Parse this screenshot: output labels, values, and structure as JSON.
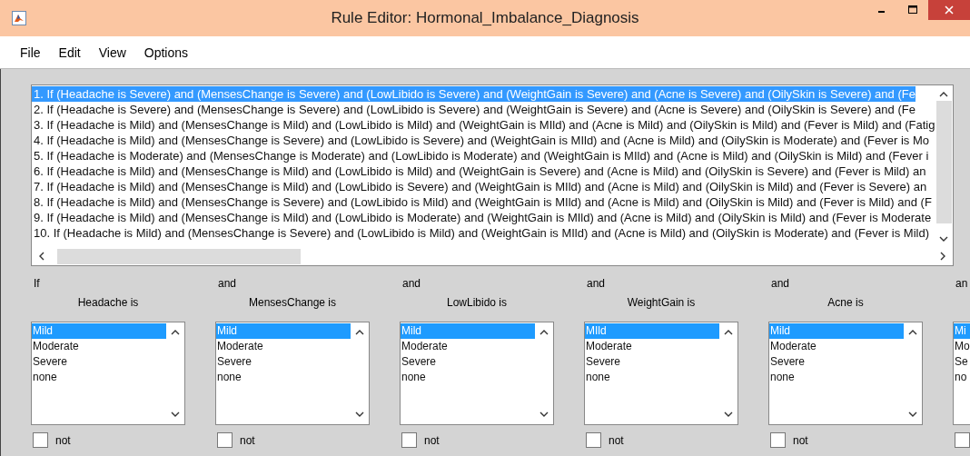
{
  "window": {
    "title": "Rule Editor: Hormonal_Imbalance_Diagnosis"
  },
  "menu": [
    "File",
    "Edit",
    "View",
    "Options"
  ],
  "rules": [
    {
      "text": "1. If (Headache is Severe) and (MensesChange is Severe) and (LowLibido is Severe) and (WeightGain is Severe) and (Acne is Severe) and (OilySkin is Severe) and (Fe",
      "selected": true
    },
    {
      "text": "2. If (Headache is Severe) and (MensesChange is Severe) and (LowLibido is Severe) and (WeightGain is Severe) and (Acne is Severe) and (OilySkin is Severe) and (Fe",
      "selected": false
    },
    {
      "text": "3. If (Headache is Mild) and (MensesChange is Mild) and (LowLibido is Mild) and (WeightGain is MIld) and (Acne is Mild) and (OilySkin is Mild) and (Fever is Mild) and (Fatig",
      "selected": false
    },
    {
      "text": "4. If (Headache is Mild) and (MensesChange is Severe) and (LowLibido is Severe) and (WeightGain is MIld) and (Acne is Mild) and (OilySkin is Moderate) and (Fever is Mo",
      "selected": false
    },
    {
      "text": "5. If (Headache is Moderate) and (MensesChange is Moderate) and (LowLibido is Moderate) and (WeightGain is MIld) and (Acne is Mild) and (OilySkin is Mild) and (Fever i",
      "selected": false
    },
    {
      "text": "6. If (Headache is Mild) and (MensesChange is Mild) and (LowLibido is Mild) and (WeightGain is Severe) and (Acne is Mild) and (OilySkin is Severe) and (Fever is Mild) an",
      "selected": false
    },
    {
      "text": "7. If (Headache is Mild) and (MensesChange is Mild) and (LowLibido is Severe) and (WeightGain is MIld) and (Acne is Mild) and (OilySkin is Mild) and (Fever is Severe) an",
      "selected": false
    },
    {
      "text": "8. If (Headache is Mild) and (MensesChange is Severe) and (LowLibido is Mild) and (WeightGain is MIld) and (Acne is Mild) and (OilySkin is Mild) and (Fever is Mild) and (F",
      "selected": false
    },
    {
      "text": "9. If (Headache is Mild) and (MensesChange is Mild) and (LowLibido is Moderate) and (WeightGain is MIld) and (Acne is Mild) and (OilySkin is Mild) and (Fever is Moderate",
      "selected": false
    },
    {
      "text": "10. If (Headache is Mild) and (MensesChange is Severe) and (LowLibido is Mild) and (WeightGain is MIld) and (Acne is Mild) and (OilySkin is Moderate) and (Fever is Mild)",
      "selected": false
    }
  ],
  "columns": [
    {
      "connector": "If",
      "header": "Headache is",
      "options": [
        {
          "label": "Mild",
          "selected": true
        },
        {
          "label": "Moderate",
          "selected": false
        },
        {
          "label": "Severe",
          "selected": false
        },
        {
          "label": "none",
          "selected": false
        }
      ],
      "not": false,
      "not_label": "not"
    },
    {
      "connector": "and",
      "header": "MensesChange is",
      "options": [
        {
          "label": "Mild",
          "selected": true
        },
        {
          "label": "Moderate",
          "selected": false
        },
        {
          "label": "Severe",
          "selected": false
        },
        {
          "label": "none",
          "selected": false
        }
      ],
      "not": false,
      "not_label": "not"
    },
    {
      "connector": "and",
      "header": "LowLibido is",
      "options": [
        {
          "label": "Mild",
          "selected": true
        },
        {
          "label": "Moderate",
          "selected": false
        },
        {
          "label": "Severe",
          "selected": false
        },
        {
          "label": "none",
          "selected": false
        }
      ],
      "not": false,
      "not_label": "not"
    },
    {
      "connector": "and",
      "header": "WeightGain is",
      "options": [
        {
          "label": "MIld",
          "selected": true
        },
        {
          "label": "Moderate",
          "selected": false
        },
        {
          "label": "Severe",
          "selected": false
        },
        {
          "label": "none",
          "selected": false
        }
      ],
      "not": false,
      "not_label": "not"
    },
    {
      "connector": "and",
      "header": "Acne is",
      "options": [
        {
          "label": "Mild",
          "selected": true
        },
        {
          "label": "Moderate",
          "selected": false
        },
        {
          "label": "Severe",
          "selected": false
        },
        {
          "label": "none",
          "selected": false
        }
      ],
      "not": false,
      "not_label": "not"
    },
    {
      "connector": "an",
      "options": [
        {
          "label": "Mi",
          "selected": true
        },
        {
          "label": "Mo",
          "selected": false
        },
        {
          "label": "Se",
          "selected": false
        },
        {
          "label": "no",
          "selected": false
        }
      ],
      "not": false
    }
  ]
}
